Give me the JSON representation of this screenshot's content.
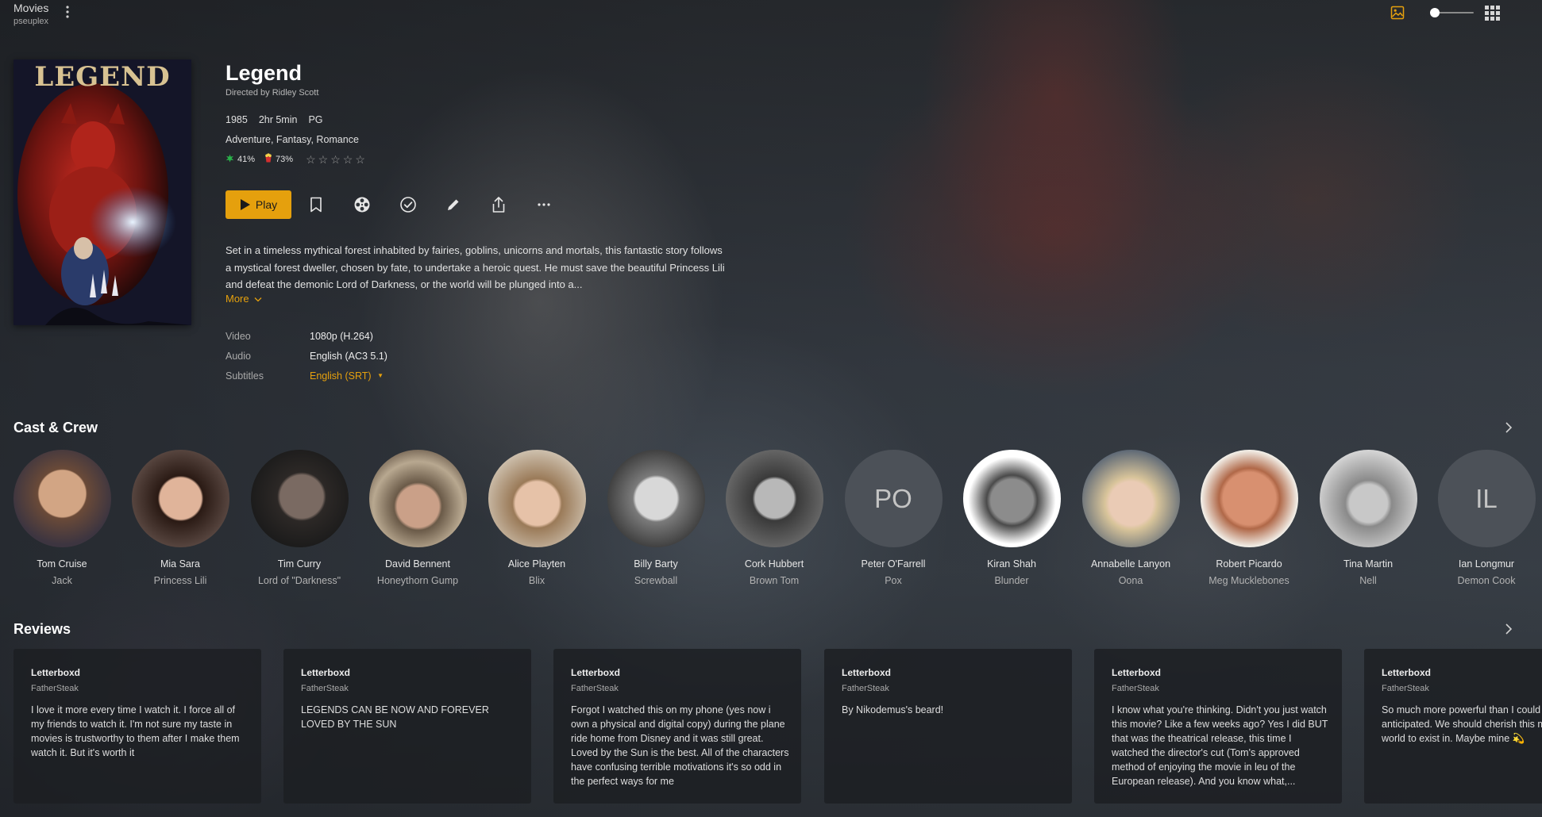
{
  "header": {
    "title": "Movies",
    "subtitle": "pseuplex"
  },
  "movie": {
    "poster_text": "LEGEND",
    "title": "Legend",
    "director": "Directed by Ridley Scott",
    "year": "1985",
    "duration": "2hr 5min",
    "rating": "PG",
    "genres": "Adventure, Fantasy, Romance",
    "critic_score": "41%",
    "audience_score": "73%",
    "user_stars": 0,
    "summary": "Set in a timeless mythical forest inhabited by fairies, goblins, unicorns and mortals, this fantastic story follows a mystical forest dweller, chosen by fate, to undertake a heroic quest. He must save the beautiful Princess Lili and defeat the demonic Lord of Darkness, or the world will be plunged into a...",
    "more_label": "More"
  },
  "actions": {
    "play_label": "Play"
  },
  "streams": {
    "video_label": "Video",
    "video_value": "1080p (H.264)",
    "audio_label": "Audio",
    "audio_value": "English (AC3 5.1)",
    "subtitles_label": "Subtitles",
    "subtitles_value": "English (SRT)"
  },
  "cast_section": {
    "title": "Cast & Crew",
    "people": [
      {
        "name": "Tom Cruise",
        "role": "Jack"
      },
      {
        "name": "Mia Sara",
        "role": "Princess Lili"
      },
      {
        "name": "Tim Curry",
        "role": "Lord of \"Darkness\""
      },
      {
        "name": "David Bennent",
        "role": "Honeythorn Gump"
      },
      {
        "name": "Alice Playten",
        "role": "Blix"
      },
      {
        "name": "Billy Barty",
        "role": "Screwball"
      },
      {
        "name": "Cork Hubbert",
        "role": "Brown Tom"
      },
      {
        "name": "Peter O'Farrell",
        "role": "Pox",
        "initials": "PO"
      },
      {
        "name": "Kiran Shah",
        "role": "Blunder"
      },
      {
        "name": "Annabelle Lanyon",
        "role": "Oona"
      },
      {
        "name": "Robert Picardo",
        "role": "Meg Mucklebones"
      },
      {
        "name": "Tina Martin",
        "role": "Nell"
      },
      {
        "name": "Ian Longmur",
        "role": "Demon Cook",
        "initials": "IL"
      }
    ]
  },
  "reviews_section": {
    "title": "Reviews",
    "items": [
      {
        "source": "Letterboxd",
        "author": "FatherSteak",
        "text": "I love it more every time I watch it. I force all of my friends to watch it. I'm not sure my taste in movies is trustworthy to them after I make them watch it. But it's worth it"
      },
      {
        "source": "Letterboxd",
        "author": "FatherSteak",
        "text": "LEGENDS CAN BE NOW AND FOREVER LOVED BY THE SUN"
      },
      {
        "source": "Letterboxd",
        "author": "FatherSteak",
        "text": "Forgot I watched this on my phone (yes now i own a physical and digital copy) during the plane ride home from Disney and it was still great. Loved by the Sun is the best. All of the characters have confusing terrible motivations it's so odd in the perfect ways for me"
      },
      {
        "source": "Letterboxd",
        "author": "FatherSteak",
        "text": "By Nikodemus's beard!"
      },
      {
        "source": "Letterboxd",
        "author": "FatherSteak",
        "text": "I know what you're thinking. Didn't you just watch this movie? Like a few weeks ago? Yes I did BUT that was the theatrical release, this time I watched the director's cut (Tom's approved method of enjoying the movie in leu of the European release). And you know what,..."
      },
      {
        "source": "Letterboxd",
        "author": "FatherSteak",
        "text": "So much more powerful than I could have anticipated. We should cherish this movie. What a world to exist in. Maybe mine 💫"
      }
    ]
  },
  "colors": {
    "accent": "#e5a00d",
    "rt_critic": "#2ab34a",
    "rt_audience": "#e8b300"
  }
}
